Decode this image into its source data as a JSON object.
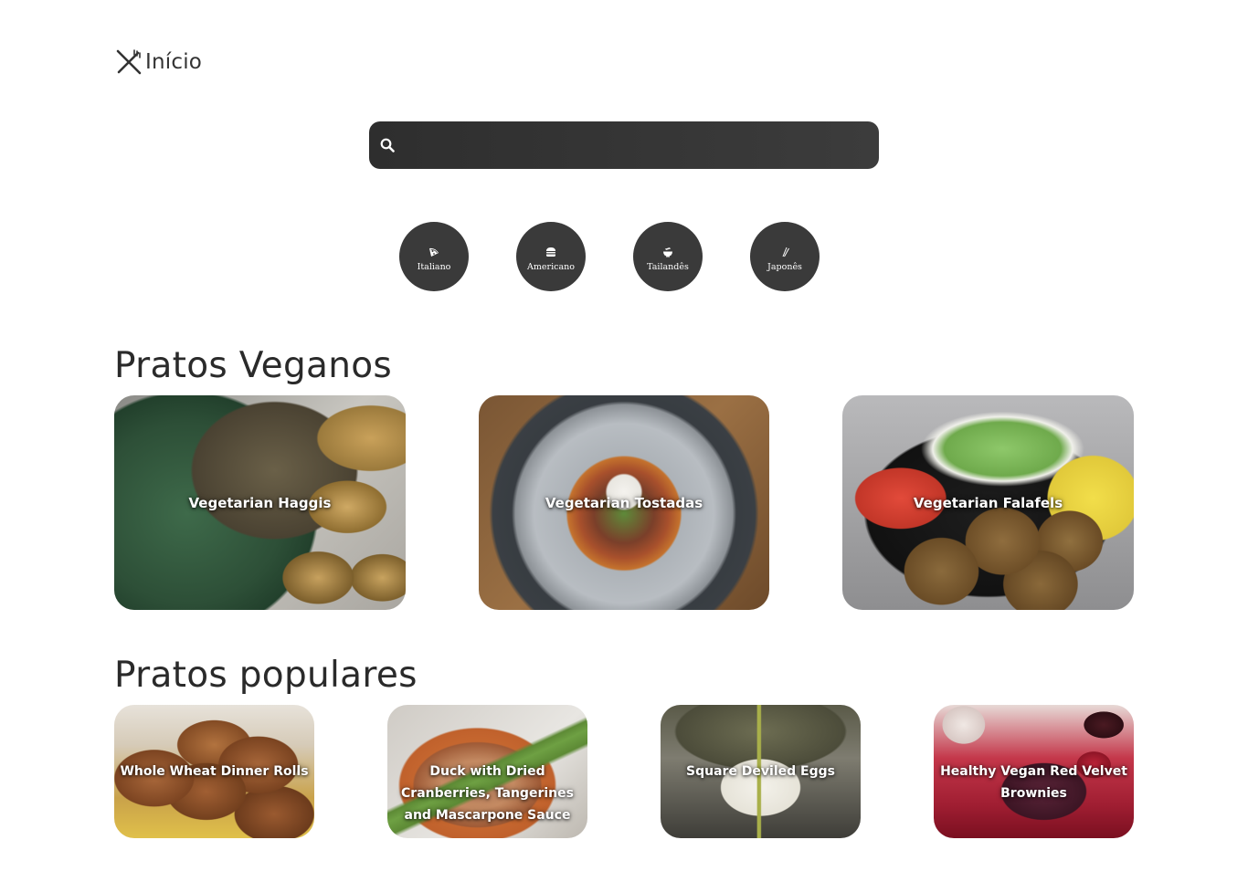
{
  "nav": {
    "logo_icon": "fork-knife-icon",
    "home_label": "Início"
  },
  "search": {
    "icon": "search-icon",
    "placeholder": "",
    "value": ""
  },
  "categories": [
    {
      "label": "Italiano",
      "icon": "pizza-icon"
    },
    {
      "label": "Americano",
      "icon": "hamburger-icon"
    },
    {
      "label": "Tailandês",
      "icon": "bowl-icon"
    },
    {
      "label": "Japonês",
      "icon": "chopsticks-icon"
    }
  ],
  "vegan": {
    "title": "Pratos Veganos",
    "items": [
      {
        "name": "Vegetarian Haggis"
      },
      {
        "name": "Vegetarian Tostadas"
      },
      {
        "name": "Vegetarian Falafels"
      }
    ]
  },
  "popular": {
    "title": "Pratos populares",
    "items": [
      {
        "name": "Whole Wheat Dinner Rolls"
      },
      {
        "name": "Duck with Dried Cranberries, Tangerines and Mascarpone Sauce"
      },
      {
        "name": "Square Deviled Eggs"
      },
      {
        "name": "Healthy Vegan Red Velvet Brownies"
      }
    ]
  },
  "colors": {
    "dark": "#3a3a3a",
    "search_bg": "#333333",
    "text": "#2a2a2a"
  }
}
